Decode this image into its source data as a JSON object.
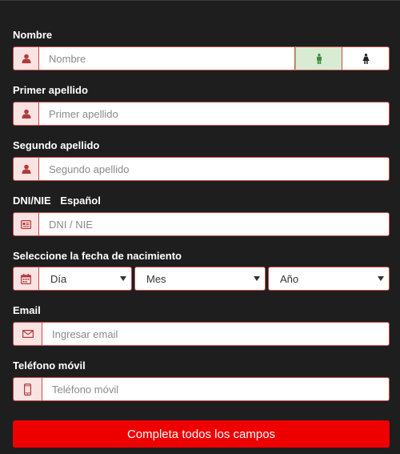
{
  "form": {
    "nombre": {
      "label": "Nombre",
      "placeholder": "Nombre",
      "icon": "user-icon",
      "gender_male_icon": "male-icon",
      "gender_female_icon": "female-icon"
    },
    "primer_apellido": {
      "label": "Primer apellido",
      "placeholder": "Primer apellido",
      "icon": "user-icon"
    },
    "segundo_apellido": {
      "label": "Segundo apellido",
      "placeholder": "Segundo apellido",
      "icon": "user-icon"
    },
    "dni": {
      "label": "DNI/NIE",
      "country": "Español",
      "placeholder": "DNI / NIE",
      "icon": "id-card-icon"
    },
    "fecha": {
      "label": "Seleccione la fecha de nacimiento",
      "icon": "calendar-icon",
      "day": "Día",
      "month": "Mes",
      "year": "Año"
    },
    "email": {
      "label": "Email",
      "placeholder": "Ingresar email",
      "icon": "envelope-icon"
    },
    "telefono": {
      "label": "Teléfono móvil",
      "placeholder": "Teléfono móvil",
      "icon": "mobile-phone-icon"
    },
    "submit_label": "Completa todos los campos"
  },
  "colors": {
    "background": "#1e1e1e",
    "accent_red": "#ee0000",
    "field_border": "#c94a4a",
    "addon_bg": "#f9e3e3",
    "icon_red": "#b33a3a",
    "male_bg": "#d7ecd2",
    "male_icon": "#3d8a3d"
  }
}
